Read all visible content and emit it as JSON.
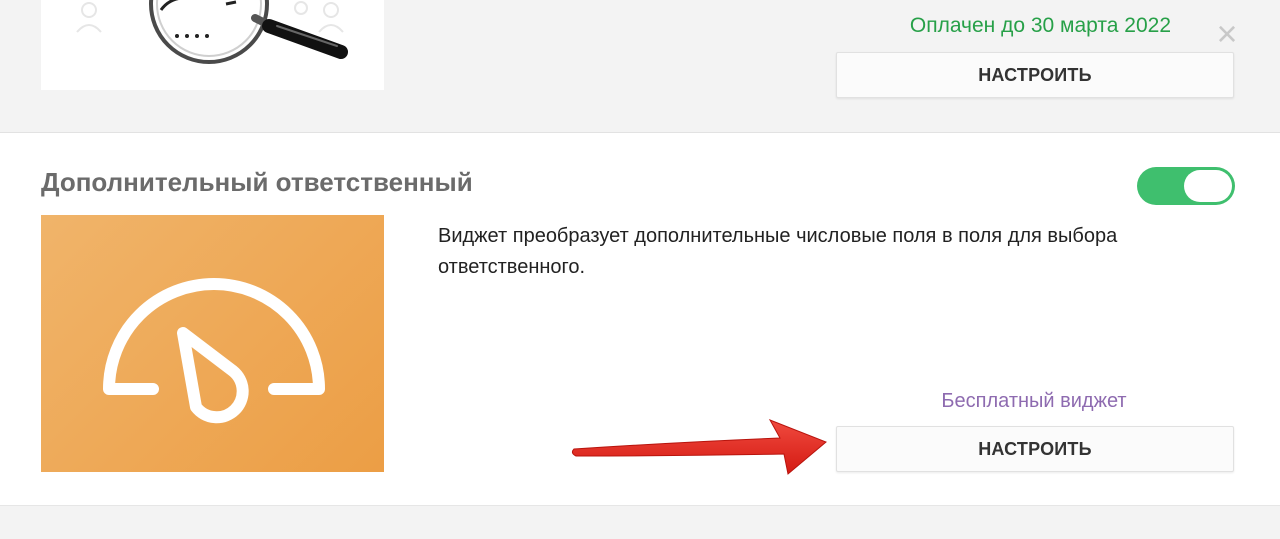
{
  "top_widget": {
    "status": "Оплачен до 30 марта 2022",
    "close_symbol": "×",
    "configure_label": "НАСТРОИТЬ"
  },
  "widget": {
    "title": "Дополнительный ответственный",
    "enabled": true,
    "description": "Виджет преобразует дополнительные числовые поля в поля для выбора ответственного.",
    "price_label": "Бесплатный виджет",
    "configure_label": "НАСТРОИТЬ"
  },
  "colors": {
    "paid_status": "#27a048",
    "toggle_on": "#3fbf6e",
    "price_label": "#8e6bb0",
    "widget_image": "#ec9e45",
    "annotation_arrow": "#e2231a"
  },
  "icons": {
    "top_thumbnail": "magnifier-icon",
    "widget_logo": "gauge-icon",
    "annotation": "red-arrow"
  }
}
